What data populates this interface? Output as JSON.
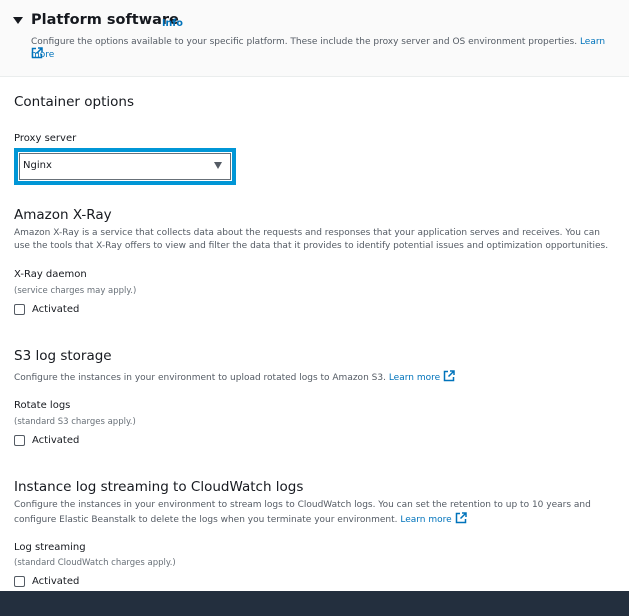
{
  "platform": {
    "title": "Platform software",
    "info_label": "Info",
    "description": "Configure the options available to your specific platform. These include the proxy server and OS environment properties.",
    "learn_more": "Learn more"
  },
  "container": {
    "title": "Container options",
    "proxy_label": "Proxy server",
    "proxy_value": "Nginx"
  },
  "xray": {
    "title": "Amazon X-Ray",
    "description": "Amazon X-Ray is a service that collects data about the requests and responses that your application serves and receives. You can use the tools that X-Ray offers to view and filter the data that it provides to identify potential issues and optimization opportunities.",
    "daemon_label": "X-Ray daemon",
    "daemon_hint": "(service charges may apply.)",
    "checkbox_label": "Activated"
  },
  "s3": {
    "title": "S3 log storage",
    "description": "Configure the instances in your environment to upload rotated logs to Amazon S3.",
    "learn_more": "Learn more",
    "rotate_label": "Rotate logs",
    "rotate_hint": "(standard S3 charges apply.)",
    "checkbox_label": "Activated"
  },
  "cloudwatch": {
    "title": "Instance log streaming to CloudWatch logs",
    "description": "Configure the instances in your environment to stream logs to CloudWatch logs. You can set the retention to up to 10 years and configure Elastic Beanstalk to delete the logs when you terminate your environment.",
    "learn_more": "Learn more",
    "stream_label": "Log streaming",
    "stream_hint": "(standard CloudWatch charges apply.)",
    "checkbox_label": "Activated"
  },
  "colors": {
    "link": "#0073bb",
    "focus_ring": "#0096d6",
    "footer": "#232f3e"
  },
  "icons": {
    "collapse": "caret-down-icon",
    "external": "external-link-icon",
    "select": "dropdown-arrow-icon"
  }
}
